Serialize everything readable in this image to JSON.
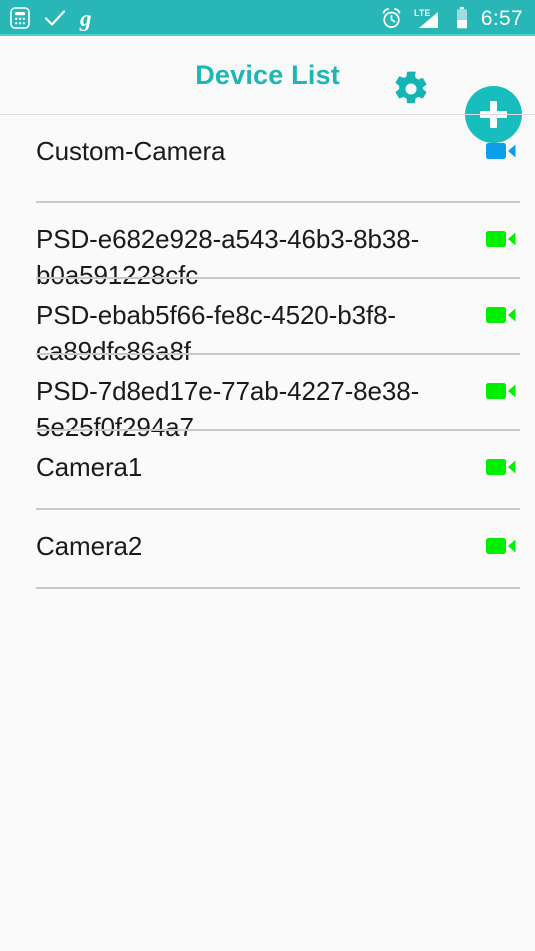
{
  "status_bar": {
    "background_color": "#29b6b6",
    "left_icons": [
      {
        "name": "calculator-icon",
        "label": "calculator"
      },
      {
        "name": "checkmark-icon",
        "label": "check"
      },
      {
        "name": "grammarly-g-icon",
        "label": "g"
      }
    ],
    "right_icons": [
      {
        "name": "alarm-clock-icon",
        "label": "alarm"
      },
      {
        "name": "lte-signal-icon",
        "label": "LTE"
      },
      {
        "name": "battery-icon",
        "label": "battery"
      }
    ],
    "network_label": "LTE",
    "time": "6:57"
  },
  "app_bar": {
    "title": "Device List",
    "title_color": "#1fb5b5",
    "settings_label": "Settings",
    "add_label": "Add device",
    "fab_color": "#18bdbd"
  },
  "device_list": {
    "icon_colors": {
      "blue": "#0b9fe8",
      "green": "#00ef00"
    },
    "items": [
      {
        "name": "Custom-Camera",
        "icon": "video-camera-icon",
        "status_color": "blue",
        "height_class": "row-h-tall"
      },
      {
        "name": "PSD-e682e928-a543-46b3-8b38-b0a591228cfc",
        "icon": "video-camera-icon",
        "status_color": "green",
        "height_class": "row-h-short"
      },
      {
        "name": "PSD-ebab5f66-fe8c-4520-b3f8-ca89dfc86a8f",
        "icon": "video-camera-icon",
        "status_color": "green",
        "height_class": "row-h-short"
      },
      {
        "name": "PSD-7d8ed17e-77ab-4227-8e38-5e25f0f294a7",
        "icon": "video-camera-icon",
        "status_color": "green",
        "height_class": "row-h-short"
      },
      {
        "name": "Camera1",
        "icon": "video-camera-icon",
        "status_color": "green",
        "height_class": "row-h-medium"
      },
      {
        "name": "Camera2",
        "icon": "video-camera-icon",
        "status_color": "green",
        "height_class": "row-h-medium"
      }
    ]
  }
}
